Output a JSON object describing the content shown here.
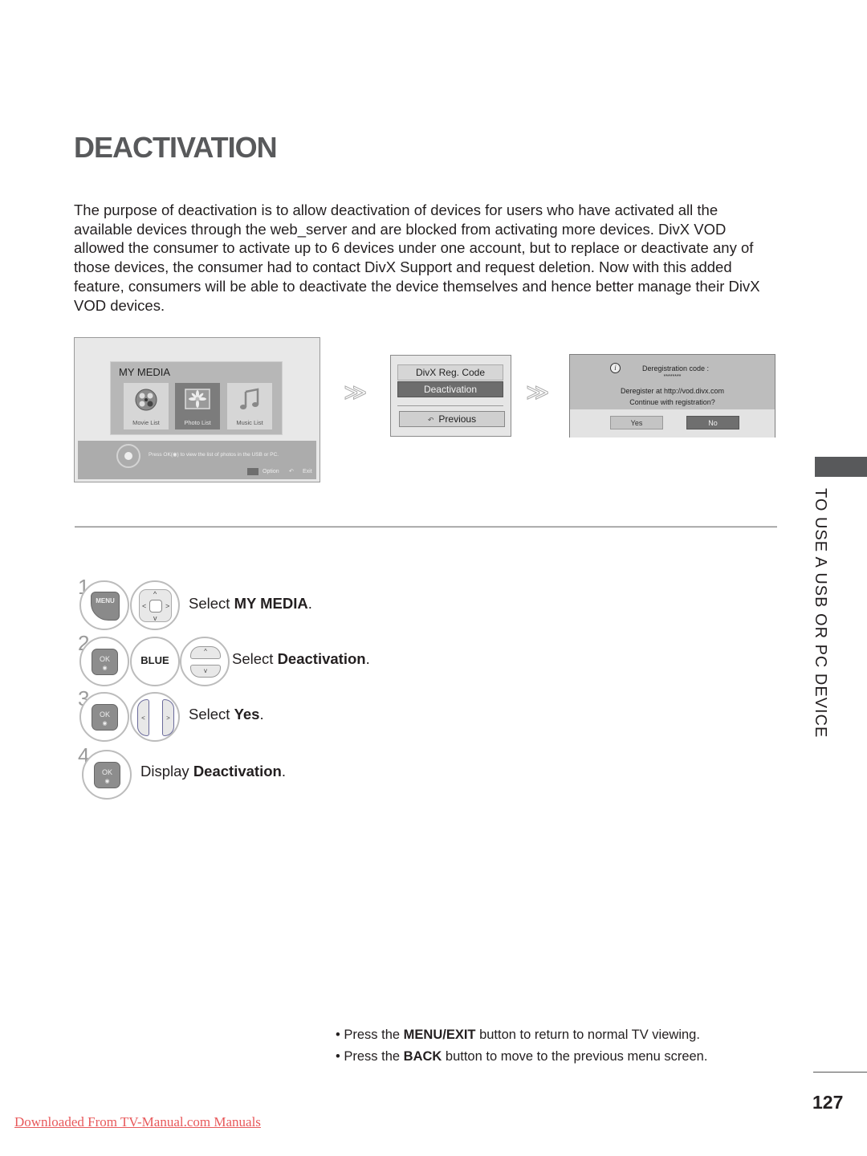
{
  "page": {
    "title": "DEACTIVATION",
    "intro": "The purpose of deactivation is to allow deactivation of devices for users who have activated all the available devices through the web_server and are blocked from activating more devices. DivX VOD allowed the consumer to activate up to 6 devices under one account, but to replace or deactivate any of those devices, the consumer had to contact DivX Support and request deletion. Now with this added feature, consumers will be able to deactivate the device themselves and hence better manage their DivX VOD devices.",
    "page_number": "127",
    "side_tab": "TO USE A USB OR PC DEVICE",
    "footer_link": "Downloaded From TV-Manual.com Manuals"
  },
  "my_media": {
    "title": "MY MEDIA",
    "tiles": [
      {
        "label": "Movie List",
        "icon": "film-reel-icon",
        "selected": false
      },
      {
        "label": "Photo List",
        "icon": "photo-icon",
        "selected": true
      },
      {
        "label": "Music List",
        "icon": "music-note-icon",
        "selected": false
      }
    ],
    "hint": "Press OK(◉) to view the list of photos in the USB or PC.",
    "option_label": "Option",
    "exit_label": "Exit"
  },
  "divx_menu": {
    "items": [
      "DivX Reg. Code",
      "Deactivation"
    ],
    "selected": "Deactivation",
    "previous_label": "Previous"
  },
  "dialog": {
    "line1": "Deregistration code :",
    "code": "********",
    "line2": "Deregister at http://vod.divx.com",
    "line3": "Continue with registration?",
    "yes_label": "Yes",
    "no_label": "No",
    "selected": "No"
  },
  "steps": [
    {
      "num": "1",
      "buttons": [
        "MENU",
        "navigation"
      ],
      "prefix": "Select ",
      "bold": "MY MEDIA",
      "suffix": "."
    },
    {
      "num": "2",
      "buttons": [
        "OK",
        "BLUE",
        "up-down"
      ],
      "prefix": "Select ",
      "bold": "Deactivation",
      "suffix": "."
    },
    {
      "num": "3",
      "buttons": [
        "OK",
        "left-right"
      ],
      "prefix": "Select ",
      "bold": "Yes",
      "suffix": "."
    },
    {
      "num": "4",
      "buttons": [
        "OK"
      ],
      "prefix": "Display ",
      "bold": "Deactivation",
      "suffix": "."
    }
  ],
  "button_labels": {
    "menu": "MENU",
    "ok": "OK",
    "blue": "BLUE"
  },
  "notes": [
    {
      "prefix": "• Press the ",
      "bold": "MENU/EXIT",
      "suffix": " button to return to normal TV viewing."
    },
    {
      "prefix": "• Press the ",
      "bold": "BACK",
      "suffix": " button to move to the previous menu screen."
    }
  ]
}
